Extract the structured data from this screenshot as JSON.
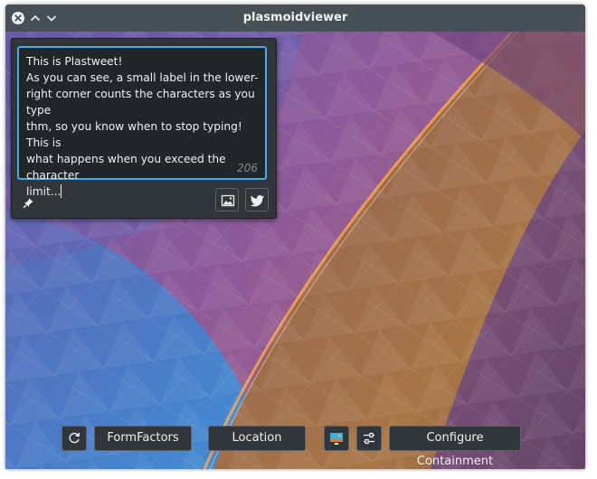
{
  "window": {
    "title": "plasmoidviewer"
  },
  "titlebar_icons": {
    "close": "close-icon",
    "maximize": "chevron-up-icon",
    "minimize": "chevron-down-icon"
  },
  "plastweet": {
    "text_lines": [
      "This is Plastweet!",
      "As you can see, a small label in the lower-",
      "right corner counts the characters as you type",
      "thm, so you know when to stop typing! This is",
      "what happens when you exceed the character",
      "limit..."
    ],
    "char_count": "206",
    "icons": {
      "pin": "pin-icon",
      "image": "image-icon",
      "twitter": "twitter-bird-icon"
    }
  },
  "toolbar": {
    "rotate_icon": "rotate-icon",
    "formfactors_label": "FormFactors",
    "location_label": "Location",
    "wallpaper_icon": "wallpaper-icon",
    "config_icon": "settings-sliders-icon",
    "configure_containment_label": "Configure Containment"
  },
  "colors": {
    "accent": "#3daee9",
    "panel_bg": "#31363b",
    "titlebar_bg": "#475057",
    "text": "#eff0f1",
    "counter": "#7f8c8d"
  }
}
